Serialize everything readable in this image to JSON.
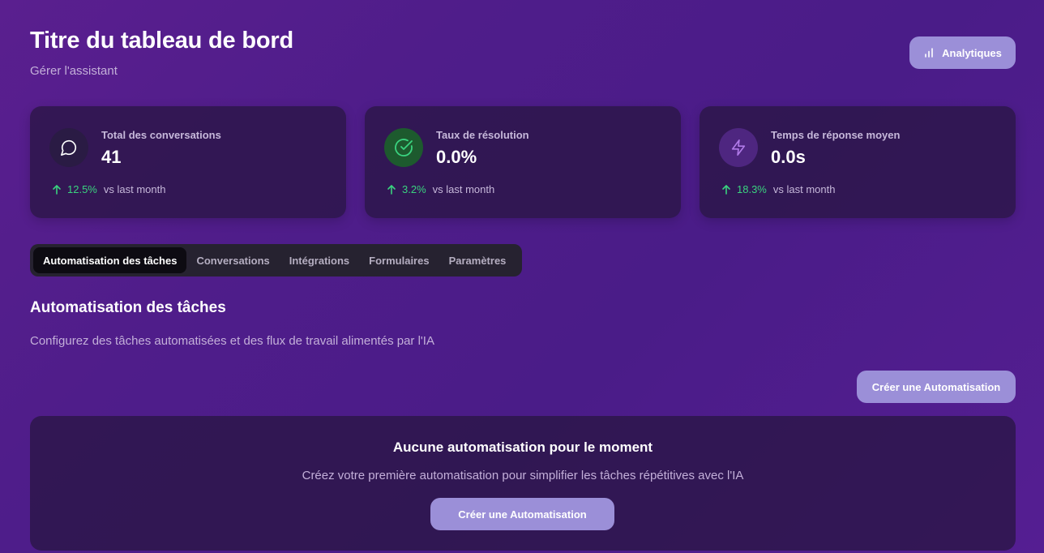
{
  "header": {
    "title": "Titre du tableau de bord",
    "subtitle": "Gérer l'assistant",
    "analytics_label": "Analytiques",
    "analytics_icon": "bar-chart-icon"
  },
  "stats": [
    {
      "label": "Total des conversations",
      "value": "41",
      "change": "12.5%",
      "comparison": "vs last month",
      "icon": "message-circle-icon",
      "icon_bg": "#2a1b44",
      "icon_color": "#ffffff"
    },
    {
      "label": "Taux de résolution",
      "value": "0.0%",
      "change": "3.2%",
      "comparison": "vs last month",
      "icon": "check-circle-icon",
      "icon_bg": "#1d5a2e",
      "icon_color": "#3ad37f"
    },
    {
      "label": "Temps de réponse moyen",
      "value": "0.0s",
      "change": "18.3%",
      "comparison": "vs last month",
      "icon": "zap-icon",
      "icon_bg": "#4e2680",
      "icon_color": "#b07ae8"
    }
  ],
  "tabs": [
    {
      "label": "Automatisation des tâches",
      "active": true
    },
    {
      "label": "Conversations",
      "active": false
    },
    {
      "label": "Intégrations",
      "active": false
    },
    {
      "label": "Formulaires",
      "active": false
    },
    {
      "label": "Paramètres",
      "active": false
    }
  ],
  "section": {
    "title": "Automatisation des tâches",
    "description": "Configurez des tâches automatisées et des flux de travail alimentés par l'IA",
    "create_label": "Créer une Automatisation"
  },
  "empty_state": {
    "title": "Aucune automatisation pour le moment",
    "description": "Créez votre première automatisation pour simplifier les tâches répétitives avec l'IA",
    "button_label": "Créer une Automatisation"
  },
  "colors": {
    "accent_button": "#9b8fd8",
    "trend_up": "#3ad37f",
    "background": "#4f1d8a"
  }
}
